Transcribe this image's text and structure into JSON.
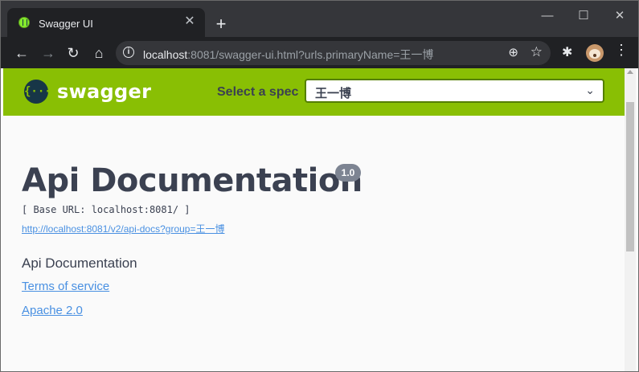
{
  "browser": {
    "tab_title": "Swagger UI",
    "tab_close": "✕",
    "new_tab": "+",
    "window_controls": {
      "minimize": "—",
      "maximize": "☐",
      "close": "✕"
    },
    "nav": {
      "back": "←",
      "forward": "→",
      "reload": "↻",
      "home": "⌂"
    },
    "url_host": "localhost",
    "url_rest": ":8081/swagger-ui.html?urls.primaryName=王一博",
    "icons": {
      "info": "i",
      "zoom": "⊕",
      "star": "☆",
      "extensions": "✱",
      "menu": "⋮"
    }
  },
  "header": {
    "logo_symbol": "{···}",
    "logo_text": "swagger",
    "spec_label": "Select a spec",
    "spec_value": "王一博",
    "chevron": "⌄"
  },
  "info": {
    "title": "Api Documentation",
    "version": "1.0",
    "base_url": "[ Base URL: localhost:8081/ ]",
    "docs_link": "http://localhost:8081/v2/api-docs?group=王一博",
    "description": "Api Documentation",
    "terms_link": "Terms of service",
    "license_link": "Apache 2.0"
  },
  "colors": {
    "swagger_green": "#89bf04",
    "text_dark": "#3b4151",
    "link_blue": "#4990e2",
    "chrome_dark": "#202124"
  }
}
